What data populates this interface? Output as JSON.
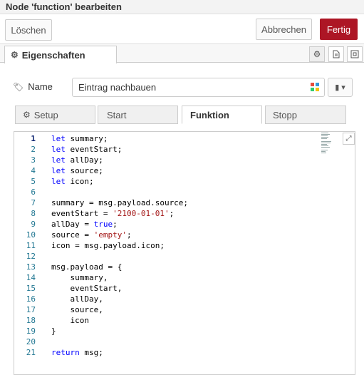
{
  "dialog": {
    "title": "Node 'function' bearbeiten",
    "delete_label": "Löschen",
    "cancel_label": "Abbrechen",
    "done_label": "Fertig"
  },
  "tabs": {
    "properties_label": "Eigenschaften"
  },
  "name_field": {
    "label": "Name",
    "value": "Eintrag nachbauen"
  },
  "subtabs": [
    {
      "label": "Setup"
    },
    {
      "label": "Start"
    },
    {
      "label": "Funktion"
    },
    {
      "label": "Stopp"
    }
  ],
  "editor": {
    "lines": [
      {
        "n": "1",
        "code": "let summary;"
      },
      {
        "n": "2",
        "code": "let eventStart;"
      },
      {
        "n": "3",
        "code": "let allDay;"
      },
      {
        "n": "4",
        "code": "let source;"
      },
      {
        "n": "5",
        "code": "let icon;"
      },
      {
        "n": "6",
        "code": ""
      },
      {
        "n": "7",
        "code": "summary = msg.payload.source;"
      },
      {
        "n": "8",
        "code": "eventStart = '2100-01-01';"
      },
      {
        "n": "9",
        "code": "allDay = true;"
      },
      {
        "n": "10",
        "code": "source = 'empty';"
      },
      {
        "n": "11",
        "code": "icon = msg.payload.icon;"
      },
      {
        "n": "12",
        "code": ""
      },
      {
        "n": "13",
        "code": "msg.payload = {"
      },
      {
        "n": "14",
        "code": "    summary,"
      },
      {
        "n": "15",
        "code": "    eventStart,"
      },
      {
        "n": "16",
        "code": "    allDay,"
      },
      {
        "n": "17",
        "code": "    source,"
      },
      {
        "n": "18",
        "code": "    icon"
      },
      {
        "n": "19",
        "code": "}"
      },
      {
        "n": "20",
        "code": ""
      },
      {
        "n": "21",
        "code": "return msg;"
      }
    ]
  },
  "colors": {
    "accent": "#ad1625",
    "keyword": "#0000ff",
    "string": "#a31515",
    "line_number": "#237893"
  }
}
